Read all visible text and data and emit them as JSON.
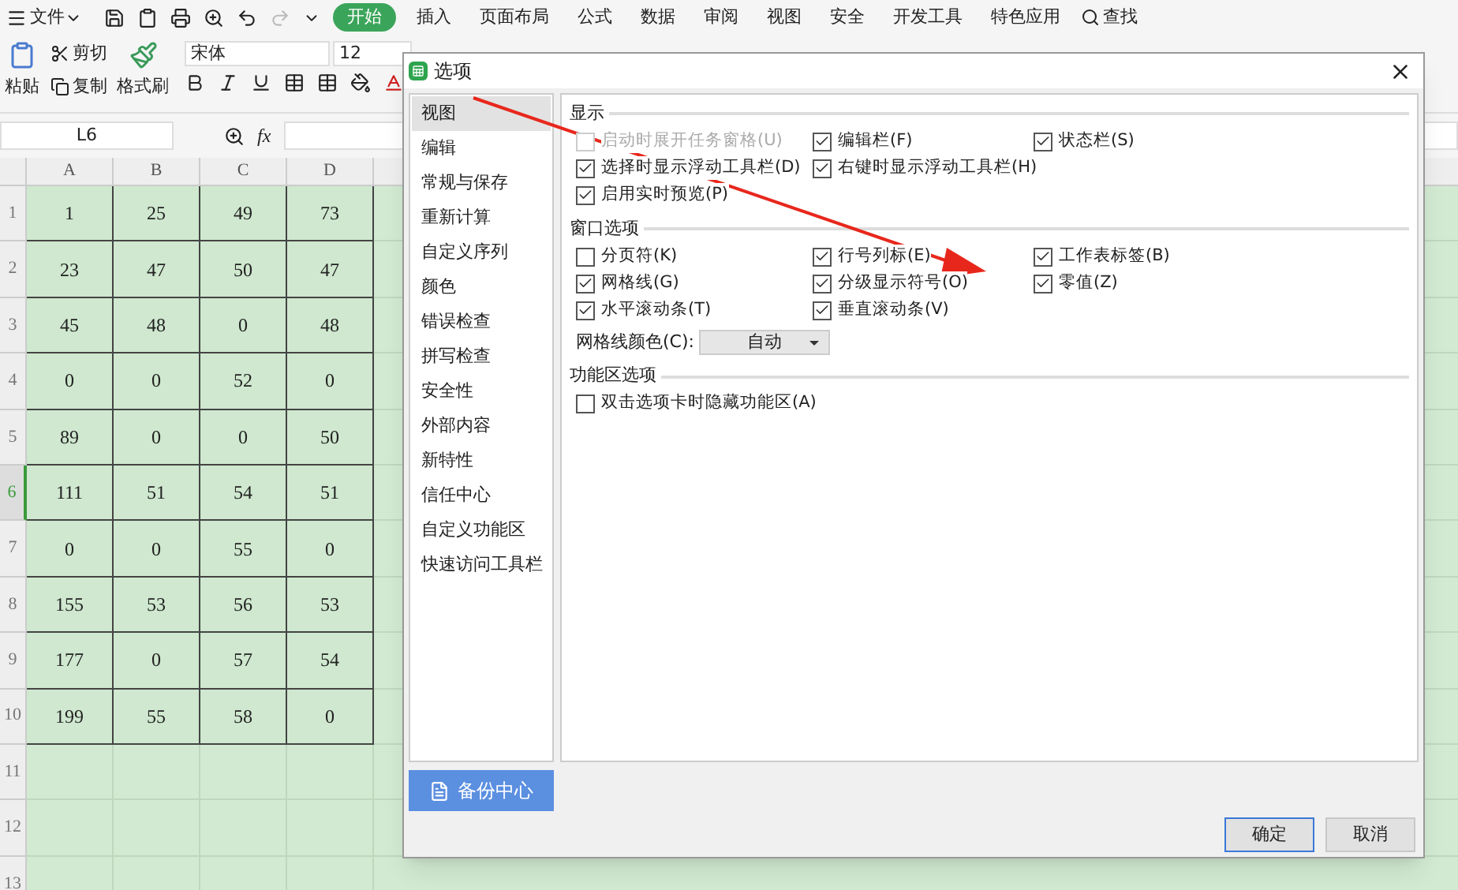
{
  "menu": {
    "file": "文件",
    "tabs": [
      {
        "label": "开始",
        "selected": true
      },
      {
        "label": "插入",
        "selected": false
      },
      {
        "label": "页面布局",
        "selected": false
      },
      {
        "label": "公式",
        "selected": false
      },
      {
        "label": "数据",
        "selected": false
      },
      {
        "label": "审阅",
        "selected": false
      },
      {
        "label": "视图",
        "selected": false
      },
      {
        "label": "安全",
        "selected": false
      },
      {
        "label": "开发工具",
        "selected": false
      },
      {
        "label": "特色应用",
        "selected": false
      }
    ],
    "search": "查找"
  },
  "ribbon": {
    "paste": "粘贴",
    "cut": "剪切",
    "copy": "复制",
    "format_painter": "格式刷",
    "font": "宋体",
    "size": "12"
  },
  "formula_bar": {
    "cell": "L6",
    "fx": "fx"
  },
  "sheet": {
    "columns": [
      "A",
      "B",
      "C",
      "D"
    ],
    "rows": [
      {
        "header": "1",
        "selected": false,
        "cells": [
          "1",
          "25",
          "49",
          "73"
        ]
      },
      {
        "header": "2",
        "selected": false,
        "cells": [
          "23",
          "47",
          "50",
          "47"
        ]
      },
      {
        "header": "3",
        "selected": false,
        "cells": [
          "45",
          "48",
          "0",
          "48"
        ]
      },
      {
        "header": "4",
        "selected": false,
        "cells": [
          "0",
          "0",
          "52",
          "0"
        ]
      },
      {
        "header": "5",
        "selected": false,
        "cells": [
          "89",
          "0",
          "0",
          "50"
        ]
      },
      {
        "header": "6",
        "selected": true,
        "cells": [
          "111",
          "51",
          "54",
          "51"
        ]
      },
      {
        "header": "7",
        "selected": false,
        "cells": [
          "0",
          "0",
          "55",
          "0"
        ]
      },
      {
        "header": "8",
        "selected": false,
        "cells": [
          "155",
          "53",
          "56",
          "53"
        ]
      },
      {
        "header": "9",
        "selected": false,
        "cells": [
          "177",
          "0",
          "57",
          "54"
        ]
      },
      {
        "header": "10",
        "selected": false,
        "cells": [
          "199",
          "55",
          "58",
          "0"
        ]
      },
      {
        "header": "11",
        "selected": false
      },
      {
        "header": "12",
        "selected": false
      },
      {
        "header": "13",
        "selected": false
      }
    ]
  },
  "dialog": {
    "title": "选项",
    "nav": [
      {
        "label": "视图",
        "selected": true
      },
      {
        "label": "编辑",
        "selected": false
      },
      {
        "label": "常规与保存",
        "selected": false
      },
      {
        "label": "重新计算",
        "selected": false
      },
      {
        "label": "自定义序列",
        "selected": false
      },
      {
        "label": "颜色",
        "selected": false
      },
      {
        "label": "错误检查",
        "selected": false
      },
      {
        "label": "拼写检查",
        "selected": false
      },
      {
        "label": "安全性",
        "selected": false
      },
      {
        "label": "外部内容",
        "selected": false
      },
      {
        "label": "新特性",
        "selected": false
      },
      {
        "label": "信任中心",
        "selected": false
      },
      {
        "label": "自定义功能区",
        "selected": false
      },
      {
        "label": "快速访问工具栏",
        "selected": false
      }
    ],
    "backup": "备份中心",
    "sections": [
      {
        "title": "显示",
        "rows": [
          [
            {
              "label": "启动时展开任务窗格(U)",
              "checked": false,
              "disabled": true
            },
            {
              "label": "编辑栏(F)",
              "checked": true,
              "disabled": false
            },
            {
              "label": "状态栏(S)",
              "checked": true,
              "disabled": false
            }
          ],
          [
            {
              "label": "选择时显示浮动工具栏(D)",
              "checked": true,
              "disabled": false
            },
            {
              "label": "右键时显示浮动工具栏(H)",
              "checked": true,
              "disabled": false
            }
          ],
          [
            {
              "label": "启用实时预览(P)",
              "checked": true,
              "disabled": false
            }
          ]
        ]
      },
      {
        "title": "窗口选项",
        "rows": [
          [
            {
              "label": "分页符(K)",
              "checked": false,
              "disabled": false
            },
            {
              "label": "行号列标(E)",
              "checked": true,
              "disabled": false
            },
            {
              "label": "工作表标签(B)",
              "checked": true,
              "disabled": false
            }
          ],
          [
            {
              "label": "网格线(G)",
              "checked": true,
              "disabled": false
            },
            {
              "label": "分级显示符号(O)",
              "checked": true,
              "disabled": false
            },
            {
              "label": "零值(Z)",
              "checked": true,
              "disabled": false
            }
          ],
          [
            {
              "label": "水平滚动条(T)",
              "checked": true,
              "disabled": false
            },
            {
              "label": "垂直滚动条(V)",
              "checked": true,
              "disabled": false
            }
          ]
        ],
        "select": {
          "label": "网格线颜色(C):",
          "value": "自动"
        }
      },
      {
        "title": "功能区选项",
        "rows": [
          [
            {
              "label": "双击选项卡时隐藏功能区(A)",
              "checked": false,
              "disabled": false
            }
          ]
        ]
      }
    ],
    "buttons": [
      "确定",
      "取消"
    ]
  }
}
